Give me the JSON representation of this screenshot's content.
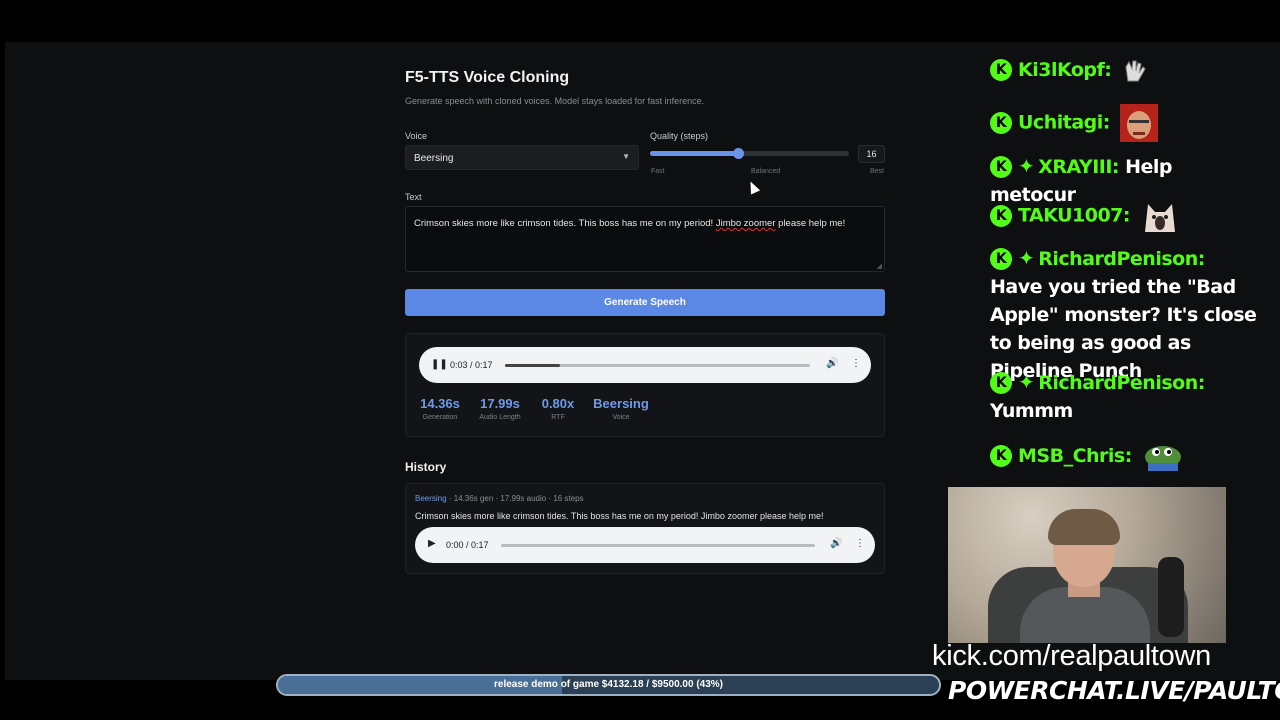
{
  "app": {
    "title": "F5-TTS Voice Cloning",
    "subtitle": "Generate speech with cloned voices. Model stays loaded for fast inference."
  },
  "form": {
    "voice_label": "Voice",
    "voice_value": "Beersing",
    "quality_label": "Quality (steps)",
    "quality_value": "16",
    "quality_fraction": 0.44,
    "tick_fast": "Fast",
    "tick_balanced": "Balanced",
    "tick_best": "Best",
    "text_label": "Text",
    "text_value_a": "Crimson skies more like crimson tides. This boss has me on my period! ",
    "text_value_b": "Jimbo zoomer",
    "text_value_c": " please help me!",
    "generate_label": "Generate Speech"
  },
  "result": {
    "player": {
      "time": "0:03 / 0:17",
      "progress": 0.18,
      "state": "pause-icon"
    },
    "stats": [
      {
        "value": "14.36s",
        "label": "Generation"
      },
      {
        "value": "17.99s",
        "label": "Audio Length"
      },
      {
        "value": "0.80x",
        "label": "RTF"
      },
      {
        "value": "Beersing",
        "label": "Voice"
      }
    ]
  },
  "history": {
    "title": "History",
    "items": [
      {
        "voice": "Beersing",
        "meta": " · 14.36s gen · 17.99s audio · 16 steps",
        "text": "Crimson skies more like crimson tides. This boss has me on my period! Jimbo zoomer please help me!",
        "player": {
          "time": "0:00 / 0:17",
          "progress": 0,
          "state": "play-icon"
        }
      }
    ]
  },
  "chat": {
    "messages": [
      {
        "user": "Ki3lKopf:",
        "text": "",
        "gem": false,
        "emote": "emote-hands"
      },
      {
        "user": "Uchitagi:",
        "text": "",
        "gem": false,
        "emote": "emote-face"
      },
      {
        "user": "XRAYIII:",
        "text": "Help metocur",
        "gem": true,
        "emote": ""
      },
      {
        "user": "TAKU1007:",
        "text": "",
        "gem": false,
        "emote": "emote-cat"
      },
      {
        "user": "RichardPenison:",
        "text": "Have you tried the \"Bad Apple\" monster? It's close to being as good as Pipeline Punch",
        "gem": true,
        "emote": ""
      },
      {
        "user": "RichardPenison:",
        "text": "Yummm",
        "gem": true,
        "emote": ""
      },
      {
        "user": "MSB_Chris:",
        "text": "",
        "gem": false,
        "emote": "emote-frog"
      }
    ],
    "badge_glyph": "K",
    "gem_glyph": "✦"
  },
  "overlay": {
    "kick_url": "kick.com/realpaultown",
    "powerchat": "POWERCHAT.LIVE/PAULTOWN",
    "goal_text": "release demo of game $4132.18 / $9500.00 (43%)",
    "goal_fraction": 0.43
  },
  "colors": {
    "accent": "#5b87e5",
    "kick_green": "#53fc18",
    "stat_blue": "#6f9ae9"
  }
}
